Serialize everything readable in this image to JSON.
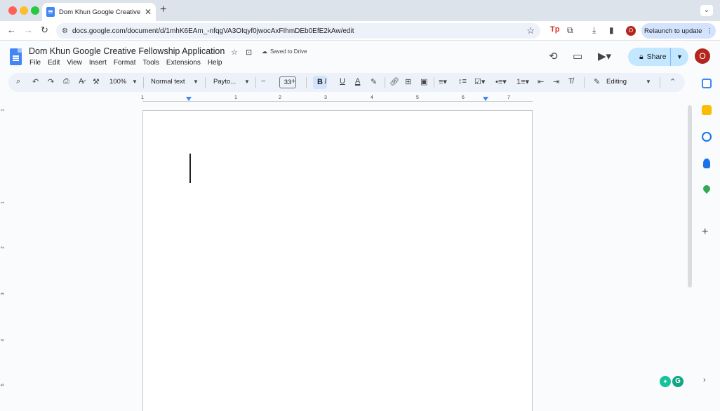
{
  "browser": {
    "tab_title": "Dom Khun Google Creative Fellowship Application - Google Docs",
    "tab_close": "✕",
    "new_tab": "+",
    "url": "docs.google.com/document/d/1mhK6EAm_-nfqgVA3OIqyf0jwocAxFIhmDEb0EfE2kAw/edit",
    "profile_initial": "O",
    "relaunch_label": "Relaunch to update",
    "extension_tp": "Tp"
  },
  "docs": {
    "title": "Dom Khun Google Creative Fellowship Application",
    "saved_status": "Saved to Drive",
    "menu": [
      "File",
      "Edit",
      "View",
      "Insert",
      "Format",
      "Tools",
      "Extensions",
      "Help"
    ],
    "share_label": "Share",
    "avatar_initial": "O"
  },
  "toolbar": {
    "zoom": "100%",
    "style": "Normal text",
    "font": "Payto...",
    "font_size": "33",
    "bold": "B",
    "italic": "I",
    "underline": "U",
    "text_color": "A",
    "mode": "Editing"
  },
  "ruler": {
    "numbers": [
      "1",
      "1",
      "2",
      "3",
      "4",
      "5",
      "6",
      "7"
    ]
  },
  "vruler": {
    "numbers": [
      "1",
      "1",
      "2",
      "3",
      "4",
      "5"
    ]
  },
  "colors": {
    "accent": "#4285f4",
    "share_bg": "#c2e7ff",
    "avatar": "#b3261e"
  }
}
